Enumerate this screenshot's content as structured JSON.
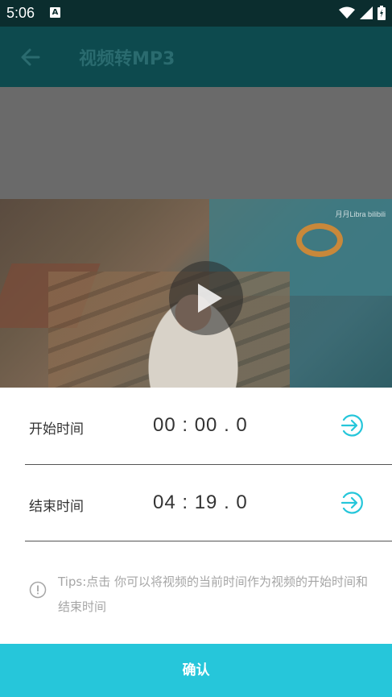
{
  "status_bar": {
    "time": "5:06",
    "notification_icon": "A"
  },
  "app_bar": {
    "title": "视频转MP3",
    "back_icon": "arrow-left"
  },
  "video": {
    "watermark": "月月Libra bilibili",
    "play_icon": "play"
  },
  "sheet": {
    "start": {
      "label": "开始时间",
      "time": "00 : 00 . 0"
    },
    "end": {
      "label": "结束时间",
      "time": "04 : 19 . 0"
    },
    "tips": "Tips:点击 你可以将视频的当前时间作为视频的开始时间和结束时间",
    "confirm_label": "确认"
  },
  "colors": {
    "accent": "#26c6da",
    "appbar": "#0d4a4e",
    "statusbar": "#0b2d2e"
  }
}
